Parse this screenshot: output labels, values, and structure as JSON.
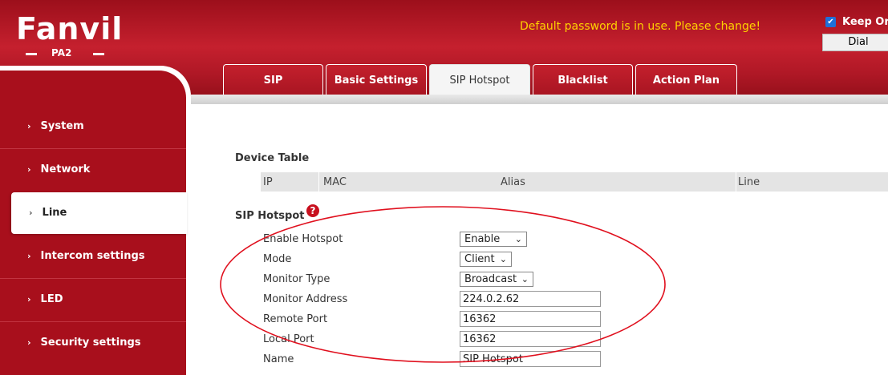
{
  "header": {
    "logo_text": "Fanvil",
    "model": "PA2",
    "warning": "Default password is in use. Please change!",
    "keep_online": "Keep Or",
    "dial_label": "Dial"
  },
  "tabs": [
    {
      "label": "SIP",
      "active": false
    },
    {
      "label": "Basic Settings",
      "active": false
    },
    {
      "label": "SIP Hotspot",
      "active": true
    },
    {
      "label": "Blacklist",
      "active": false
    },
    {
      "label": "Action Plan",
      "active": false
    }
  ],
  "sidebar": {
    "items": [
      {
        "label": "System",
        "active": false
      },
      {
        "label": "Network",
        "active": false
      },
      {
        "label": "Line",
        "active": true
      },
      {
        "label": "Intercom settings",
        "active": false
      },
      {
        "label": "LED",
        "active": false
      },
      {
        "label": "Security settings",
        "active": false
      }
    ]
  },
  "device_table": {
    "title": "Device Table",
    "columns": [
      "IP",
      "MAC",
      "Alias",
      "Line"
    ]
  },
  "sip_hotspot": {
    "title": "SIP Hotspot",
    "fields": {
      "enable_hotspot": {
        "label": "Enable Hotspot",
        "value": "Enable"
      },
      "mode": {
        "label": "Mode",
        "value": "Client"
      },
      "monitor_type": {
        "label": "Monitor Type",
        "value": "Broadcast"
      },
      "monitor_address": {
        "label": "Monitor Address",
        "value": "224.0.2.62"
      },
      "remote_port": {
        "label": "Remote Port",
        "value": "16362"
      },
      "local_port": {
        "label": "Local Port",
        "value": "16362"
      },
      "name": {
        "label": "Name",
        "value": "SIP Hotspot"
      }
    }
  },
  "icons": {
    "chevron": "›",
    "select_arrow": "⌄",
    "check": "✔",
    "help": "?"
  },
  "colors": {
    "brand_red": "#c5202e",
    "sidebar_red": "#a80f1c",
    "warning_yellow": "#ffd200",
    "annotation_red": "#e0101e"
  }
}
